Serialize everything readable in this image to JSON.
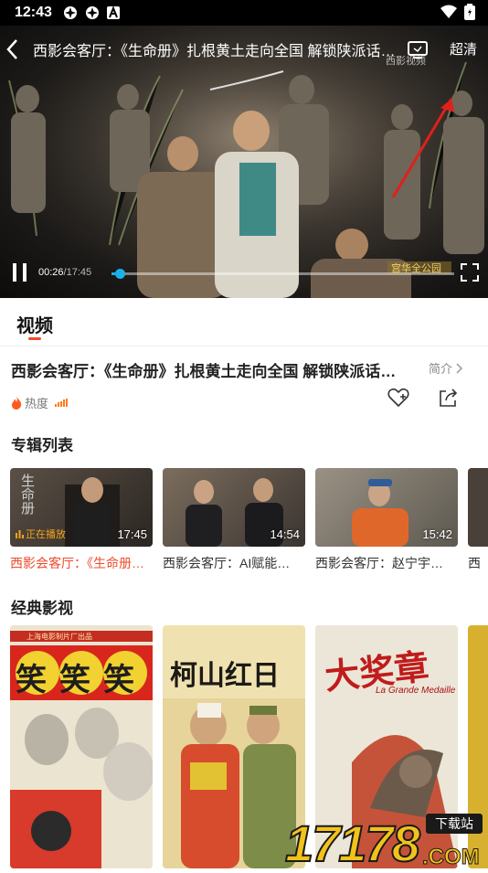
{
  "status_bar": {
    "time": "12:43"
  },
  "player": {
    "title": "西影会客厅：《生命册》扎根黄土走向全国 解锁陕派话剧密码",
    "quality": "超清",
    "current_time": "00:26",
    "total_time": "17:45",
    "progress_fraction": 0.025,
    "stage_banner": "宫华全公园",
    "logo_text": "西影视频"
  },
  "tab": {
    "label": "视频"
  },
  "info": {
    "title": "西影会客厅：《生命册》扎根黄土走向全国 解锁陕派话剧密码",
    "intro_label": "简介",
    "heat_label": "热度"
  },
  "album": {
    "section_title": "专辑列表",
    "items": [
      {
        "caption": "西影会客厅：《生命册》扎根黄土走向全国",
        "duration": "17:45",
        "playing_label": "正在播放",
        "thumb_text": "生命册"
      },
      {
        "caption": "西影会客厅：AI赋能电影产业",
        "duration": "14:54"
      },
      {
        "caption": "西影会客厅：赵宁宇教授",
        "duration": "15:42"
      },
      {
        "caption": "西"
      }
    ]
  },
  "classics": {
    "section_title": "经典影视",
    "posters": [
      {
        "title": "笑笑笑",
        "top_text": "上海电影制片厂出品"
      },
      {
        "title": "柯山红日"
      },
      {
        "title": "大奖章",
        "subtitle": "La Grande Medaille"
      }
    ]
  },
  "watermark": {
    "main": "17178",
    "sub": ".COM",
    "badge": "下载站"
  },
  "colors": {
    "accent": "#ee4b2b",
    "progress": "#1ab0e8",
    "heat": "#ff7a1a"
  }
}
